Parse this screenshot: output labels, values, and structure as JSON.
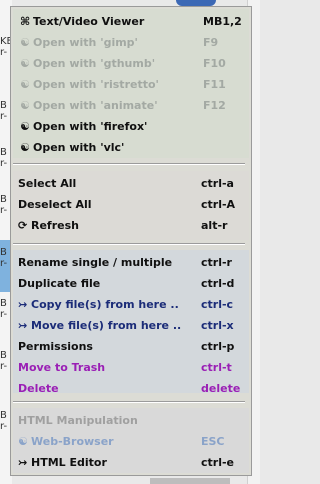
{
  "background": {
    "fragments": [
      "KE",
      "r-",
      "B",
      "r-",
      "B",
      "r-",
      "B",
      "r-",
      "B",
      "r-",
      "B",
      "r-",
      "B",
      "r-",
      "B",
      "r-"
    ]
  },
  "menu": {
    "section1": [
      {
        "icon": "⌘",
        "label": "Text/Video Viewer",
        "shortcut": "MB1,2",
        "state": "enabled"
      },
      {
        "icon": "☯",
        "label": "Open with 'gimp'",
        "shortcut": "F9",
        "state": "disabled"
      },
      {
        "icon": "☯",
        "label": "Open with 'gthumb'",
        "shortcut": "F10",
        "state": "disabled"
      },
      {
        "icon": "☯",
        "label": "Open with 'ristretto'",
        "shortcut": "F11",
        "state": "disabled"
      },
      {
        "icon": "☯",
        "label": "Open with 'animate'",
        "shortcut": "F12",
        "state": "disabled"
      },
      {
        "icon": "☯",
        "label": "Open with 'firefox'",
        "shortcut": "",
        "state": "enabled"
      },
      {
        "icon": "☯",
        "label": "Open with 'vlc'",
        "shortcut": "",
        "state": "enabled"
      }
    ],
    "section2": [
      {
        "icon": "",
        "label": "Select All",
        "shortcut": "ctrl-a"
      },
      {
        "icon": "",
        "label": "Deselect All",
        "shortcut": "ctrl-A"
      },
      {
        "icon": "⟳",
        "label": "Refresh",
        "shortcut": "alt-r"
      }
    ],
    "section3": [
      {
        "icon": "",
        "label": "Rename single / multiple",
        "shortcut": "ctrl-r"
      },
      {
        "icon": "",
        "label": "Duplicate file",
        "shortcut": "ctrl-d"
      },
      {
        "icon": "↣",
        "label": "Copy file(s) from here ..",
        "shortcut": "ctrl-c"
      },
      {
        "icon": "↣",
        "label": "Move file(s) from here ..",
        "shortcut": "ctrl-x"
      },
      {
        "icon": "",
        "label": "Permissions",
        "shortcut": "ctrl-p"
      },
      {
        "icon": "",
        "label": "Move to Trash",
        "shortcut": "ctrl-t"
      },
      {
        "icon": "",
        "label": "Delete",
        "shortcut": "delete"
      }
    ],
    "section4": {
      "heading": "HTML Manipulation",
      "items": [
        {
          "icon": "☯",
          "label": "Web-Browser",
          "shortcut": "ESC"
        },
        {
          "icon": "↣",
          "label": "HTML Editor",
          "shortcut": "ctrl-e"
        }
      ]
    },
    "colors": {
      "normal": "#101010",
      "disabled": "#a3a9a3",
      "navy": "#1b2c78",
      "purple": "#9a1fb5",
      "blue_gray": "#8aa3c9"
    }
  }
}
